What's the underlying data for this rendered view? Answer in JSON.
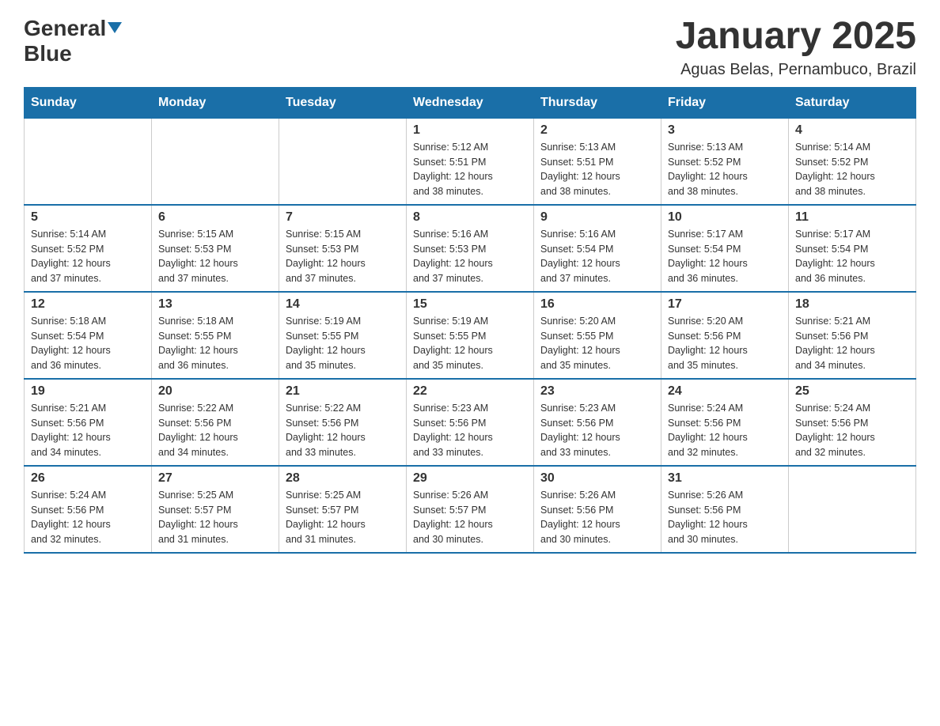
{
  "header": {
    "logo_general": "General",
    "logo_blue": "Blue",
    "title": "January 2025",
    "subtitle": "Aguas Belas, Pernambuco, Brazil"
  },
  "calendar": {
    "headers": [
      "Sunday",
      "Monday",
      "Tuesday",
      "Wednesday",
      "Thursday",
      "Friday",
      "Saturday"
    ],
    "weeks": [
      [
        {
          "day": "",
          "info": ""
        },
        {
          "day": "",
          "info": ""
        },
        {
          "day": "",
          "info": ""
        },
        {
          "day": "1",
          "info": "Sunrise: 5:12 AM\nSunset: 5:51 PM\nDaylight: 12 hours\nand 38 minutes."
        },
        {
          "day": "2",
          "info": "Sunrise: 5:13 AM\nSunset: 5:51 PM\nDaylight: 12 hours\nand 38 minutes."
        },
        {
          "day": "3",
          "info": "Sunrise: 5:13 AM\nSunset: 5:52 PM\nDaylight: 12 hours\nand 38 minutes."
        },
        {
          "day": "4",
          "info": "Sunrise: 5:14 AM\nSunset: 5:52 PM\nDaylight: 12 hours\nand 38 minutes."
        }
      ],
      [
        {
          "day": "5",
          "info": "Sunrise: 5:14 AM\nSunset: 5:52 PM\nDaylight: 12 hours\nand 37 minutes."
        },
        {
          "day": "6",
          "info": "Sunrise: 5:15 AM\nSunset: 5:53 PM\nDaylight: 12 hours\nand 37 minutes."
        },
        {
          "day": "7",
          "info": "Sunrise: 5:15 AM\nSunset: 5:53 PM\nDaylight: 12 hours\nand 37 minutes."
        },
        {
          "day": "8",
          "info": "Sunrise: 5:16 AM\nSunset: 5:53 PM\nDaylight: 12 hours\nand 37 minutes."
        },
        {
          "day": "9",
          "info": "Sunrise: 5:16 AM\nSunset: 5:54 PM\nDaylight: 12 hours\nand 37 minutes."
        },
        {
          "day": "10",
          "info": "Sunrise: 5:17 AM\nSunset: 5:54 PM\nDaylight: 12 hours\nand 36 minutes."
        },
        {
          "day": "11",
          "info": "Sunrise: 5:17 AM\nSunset: 5:54 PM\nDaylight: 12 hours\nand 36 minutes."
        }
      ],
      [
        {
          "day": "12",
          "info": "Sunrise: 5:18 AM\nSunset: 5:54 PM\nDaylight: 12 hours\nand 36 minutes."
        },
        {
          "day": "13",
          "info": "Sunrise: 5:18 AM\nSunset: 5:55 PM\nDaylight: 12 hours\nand 36 minutes."
        },
        {
          "day": "14",
          "info": "Sunrise: 5:19 AM\nSunset: 5:55 PM\nDaylight: 12 hours\nand 35 minutes."
        },
        {
          "day": "15",
          "info": "Sunrise: 5:19 AM\nSunset: 5:55 PM\nDaylight: 12 hours\nand 35 minutes."
        },
        {
          "day": "16",
          "info": "Sunrise: 5:20 AM\nSunset: 5:55 PM\nDaylight: 12 hours\nand 35 minutes."
        },
        {
          "day": "17",
          "info": "Sunrise: 5:20 AM\nSunset: 5:56 PM\nDaylight: 12 hours\nand 35 minutes."
        },
        {
          "day": "18",
          "info": "Sunrise: 5:21 AM\nSunset: 5:56 PM\nDaylight: 12 hours\nand 34 minutes."
        }
      ],
      [
        {
          "day": "19",
          "info": "Sunrise: 5:21 AM\nSunset: 5:56 PM\nDaylight: 12 hours\nand 34 minutes."
        },
        {
          "day": "20",
          "info": "Sunrise: 5:22 AM\nSunset: 5:56 PM\nDaylight: 12 hours\nand 34 minutes."
        },
        {
          "day": "21",
          "info": "Sunrise: 5:22 AM\nSunset: 5:56 PM\nDaylight: 12 hours\nand 33 minutes."
        },
        {
          "day": "22",
          "info": "Sunrise: 5:23 AM\nSunset: 5:56 PM\nDaylight: 12 hours\nand 33 minutes."
        },
        {
          "day": "23",
          "info": "Sunrise: 5:23 AM\nSunset: 5:56 PM\nDaylight: 12 hours\nand 33 minutes."
        },
        {
          "day": "24",
          "info": "Sunrise: 5:24 AM\nSunset: 5:56 PM\nDaylight: 12 hours\nand 32 minutes."
        },
        {
          "day": "25",
          "info": "Sunrise: 5:24 AM\nSunset: 5:56 PM\nDaylight: 12 hours\nand 32 minutes."
        }
      ],
      [
        {
          "day": "26",
          "info": "Sunrise: 5:24 AM\nSunset: 5:56 PM\nDaylight: 12 hours\nand 32 minutes."
        },
        {
          "day": "27",
          "info": "Sunrise: 5:25 AM\nSunset: 5:57 PM\nDaylight: 12 hours\nand 31 minutes."
        },
        {
          "day": "28",
          "info": "Sunrise: 5:25 AM\nSunset: 5:57 PM\nDaylight: 12 hours\nand 31 minutes."
        },
        {
          "day": "29",
          "info": "Sunrise: 5:26 AM\nSunset: 5:57 PM\nDaylight: 12 hours\nand 30 minutes."
        },
        {
          "day": "30",
          "info": "Sunrise: 5:26 AM\nSunset: 5:56 PM\nDaylight: 12 hours\nand 30 minutes."
        },
        {
          "day": "31",
          "info": "Sunrise: 5:26 AM\nSunset: 5:56 PM\nDaylight: 12 hours\nand 30 minutes."
        },
        {
          "day": "",
          "info": ""
        }
      ]
    ]
  }
}
